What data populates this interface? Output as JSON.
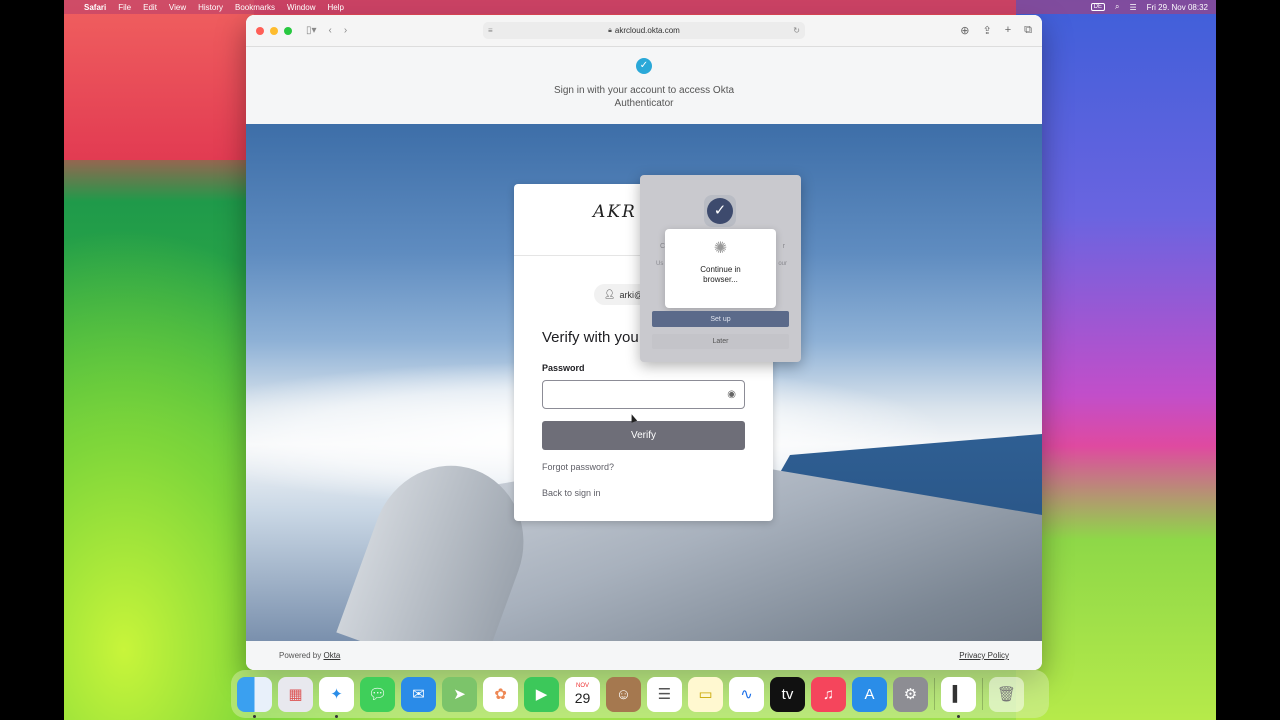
{
  "menubar": {
    "app": "Safari",
    "items": [
      "File",
      "Edit",
      "View",
      "History",
      "Bookmarks",
      "Window",
      "Help"
    ],
    "input_source": "DE",
    "datetime": "Fri 29. Nov  08:32"
  },
  "browser": {
    "url": "akrcloud.okta.com"
  },
  "page": {
    "header_message": "Sign in with your account to access Okta Authenticator",
    "footer": {
      "powered_by": "Powered by",
      "powered_by_link": "Okta",
      "privacy": "Privacy Policy"
    }
  },
  "login": {
    "brand": "AKR",
    "user": "arki@",
    "heading": "Verify with you",
    "password_label": "Password",
    "password_value": "",
    "verify_button": "Verify",
    "forgot_link": "Forgot password?",
    "back_link": "Back to sign in"
  },
  "authenticator_popup": {
    "ghost_title_left": "C",
    "ghost_title_right": "r",
    "ghost_text_left": "Us",
    "ghost_text_right": "our",
    "toast_text": "Continue in browser...",
    "setup_button": "Set up",
    "later_button": "Later"
  },
  "dock": {
    "calendar_month": "NOV",
    "calendar_day": "29",
    "apps": [
      "Finder",
      "Launchpad",
      "Safari",
      "Messages",
      "Mail",
      "Maps",
      "Photos",
      "FaceTime",
      "Calendar",
      "Contacts",
      "Reminders",
      "Notes",
      "Freeform",
      "TV",
      "Music",
      "App Store",
      "System Settings",
      "Okta Verify",
      "Trash"
    ]
  }
}
